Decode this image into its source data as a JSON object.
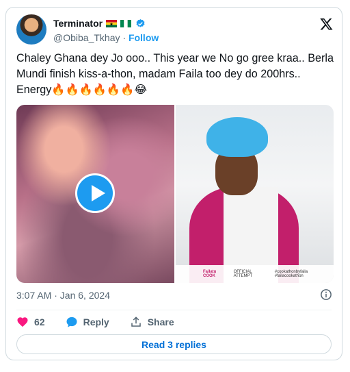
{
  "author": {
    "display_name": "Terminator",
    "flag_icons": [
      "ghana-flag-icon",
      "nigeria-flag-icon"
    ],
    "handle": "@Obiba_Tkhay",
    "separator": "·",
    "follow_label": "Follow"
  },
  "tweet": {
    "text": "Chaley Ghana dey Jo ooo.. This year we No go gree kraa.. Berla Mundi finish kiss-a-thon, madam Faila too dey do 200hrs.. Energy🔥🔥🔥🔥🔥🔥😂",
    "timestamp": "3:07 AM · Jan 6, 2024"
  },
  "media": {
    "right_caption": {
      "name_line": "Failatu COOK",
      "sub_line": "OFFICIAL ATTEMPT",
      "hashtags": "#cookathonbyfaila #failacookathon"
    }
  },
  "actions": {
    "like_count": "62",
    "reply_label": "Reply",
    "share_label": "Share"
  },
  "read_replies_label": "Read 3 replies",
  "colors": {
    "accent": "#1d9bf0",
    "like": "#f91880",
    "link": "#006fd6",
    "muted": "#536471"
  }
}
